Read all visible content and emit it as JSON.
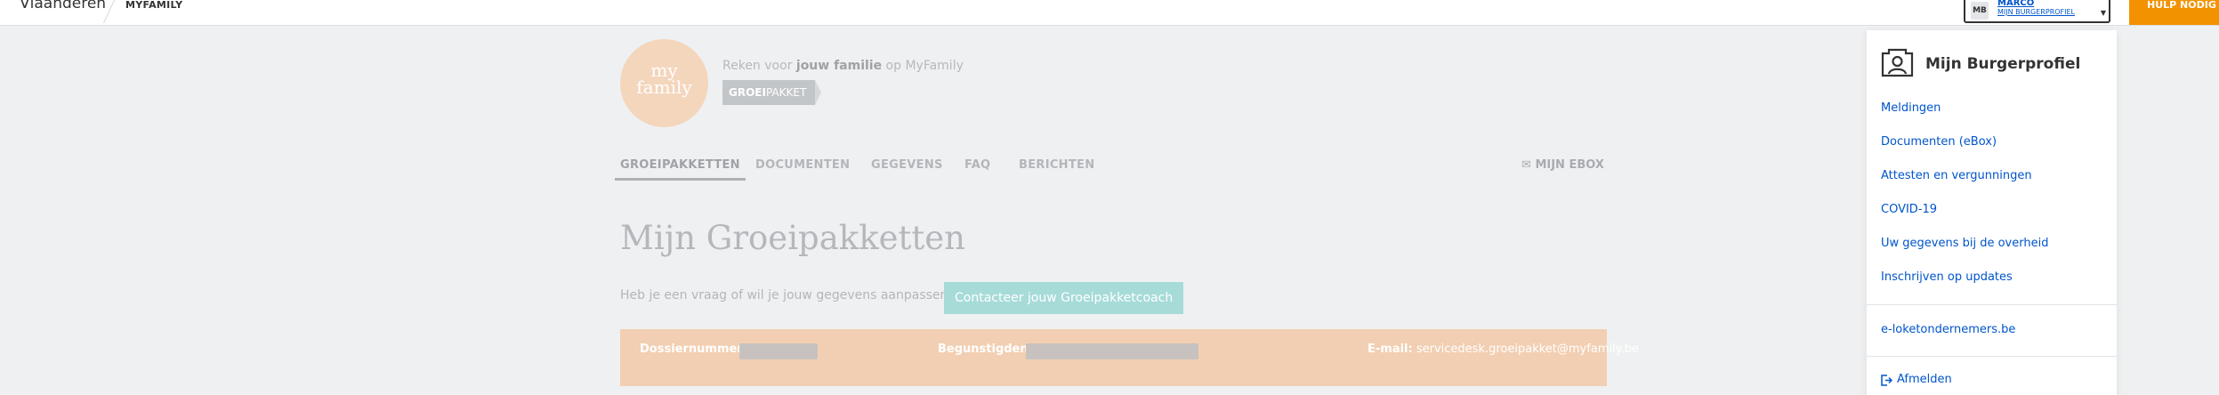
{
  "header": {
    "brand": "Vlaanderen",
    "app_name": "MYFAMILY",
    "profile": {
      "initials": "MB",
      "name": "MARCO",
      "subtitle": "MIJN BURGERPROFIEL"
    },
    "help_label": "HULP NODIG"
  },
  "hero": {
    "logo_line1": "my",
    "logo_line2": "family",
    "tagline_pre": "Reken voor ",
    "tagline_bold": "jouw familie",
    "tagline_post": " op MyFamily",
    "tag_bold": "GROEI",
    "tag_rest": "PAKKET"
  },
  "nav": {
    "tabs": [
      {
        "label": "GROEIPAKKETTEN",
        "active": true
      },
      {
        "label": "DOCUMENTEN"
      },
      {
        "label": "GEGEVENS"
      },
      {
        "label": "FAQ"
      },
      {
        "label": "BERICHTEN"
      }
    ],
    "ebox_label": "MIJN EBOX"
  },
  "main": {
    "title": "Mijn Groeipakketten",
    "question": "Heb je een vraag of wil je jouw gegevens aanpassen?",
    "coach_button": "Contacteer jouw Groeipakketcoach",
    "dossier_label": "Dossiernummer:",
    "beneficiaries_label": "Begunstigden:",
    "email_label": "E-mail:",
    "email_value": "servicedesk.groeipakket@myfamily.be"
  },
  "panel": {
    "title": "Mijn Burgerprofiel",
    "links": [
      "Meldingen",
      "Documenten (eBox)",
      "Attesten en vergunningen",
      "COVID-19",
      "Uw gegevens bij de overheid",
      "Inschrijven op updates"
    ],
    "business_link": "e-loketondernemers.be",
    "logout": "Afmelden"
  },
  "colors": {
    "link_blue": "#0055cc",
    "help_orange": "#f39200",
    "coach_teal": "#a6dbd8",
    "dossier_peach": "#f2cfb2"
  }
}
